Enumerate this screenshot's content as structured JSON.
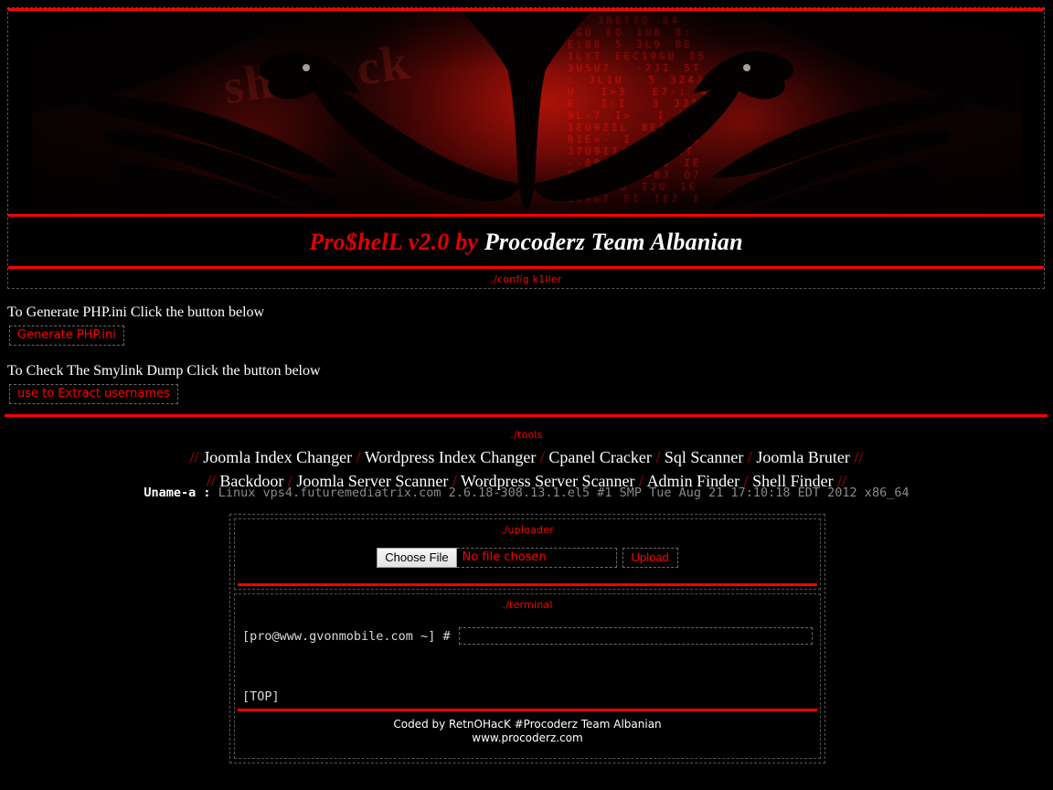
{
  "header": {
    "title_red": "Pro$helL v2.0 by ",
    "title_white": "Procoderz Team Albanian",
    "banner_code_text": "7E 3R6T7Q 84\n>GQ EQ 1U8 8:\nE:88 5 3L9 8E\n1LYT EEC19GU I5\n3U5U7  -7JI 5T\n: JL1U  5 3Z4J\nU  I>3  E7-: 4\nR  I:I  3 JJIE\n9L-7 I>  I 3T-\n1EU9ZIL 8E9 G>\n01E>- I 81JI 3\nJ7U9I7/E-JI 3T\n--88 J1 RE8 IE\nE9K 1UQ >8J Q7\n11UE5-8 IJU 1E\n1I9G7 EI 1EJ I",
    "banner_blur_text": "sh\nab\nck"
  },
  "configkiller": {
    "label": "./config k1ller",
    "php_ini_text": "To Generate PHP.ini Click the button below",
    "php_ini_button": "Generate PHP.ini",
    "symlink_text": "To Check The Smylink Dump Click the button below",
    "symlink_button": "use to Extract usernames"
  },
  "tools": {
    "label": "./tools",
    "row1": [
      "Joomla Index Changer",
      "Wordpress Index Changer",
      "Cpanel Cracker",
      "Sql Scanner",
      "Joomla Bruter"
    ],
    "row2": [
      "Backdoor",
      "Joomla Server Scanner",
      "Wordpress Server Scanner",
      "Admin Finder",
      "Shell Finder"
    ],
    "outer_sep": "//",
    "inner_sep": "/"
  },
  "uname": {
    "label": "Uname-a :",
    "value": "Linux vps4.futuremediatrix.com 2.6.18-308.13.1.el5 #1 SMP Tue Aug 21 17:10:18 EDT 2012 x86_64"
  },
  "uploader": {
    "label": "./uploader",
    "choose_file_button": "Choose File",
    "file_name": "No file chosen",
    "upload_button": "Upload"
  },
  "terminal": {
    "label": "./terminal",
    "prompt": "[pro@www.gvonmobile.com ~] #",
    "command_value": "",
    "top_link": "[TOP]"
  },
  "footer": {
    "credit": "Coded by RetnOHacK #Procoderz Team Albanian",
    "site": "www.procoderz.com"
  },
  "colors": {
    "accent_red": "#ff0000",
    "title_red": "#e00000",
    "background": "#000000",
    "dashed_border": "#555555",
    "muted_text": "#8a8a8a"
  }
}
